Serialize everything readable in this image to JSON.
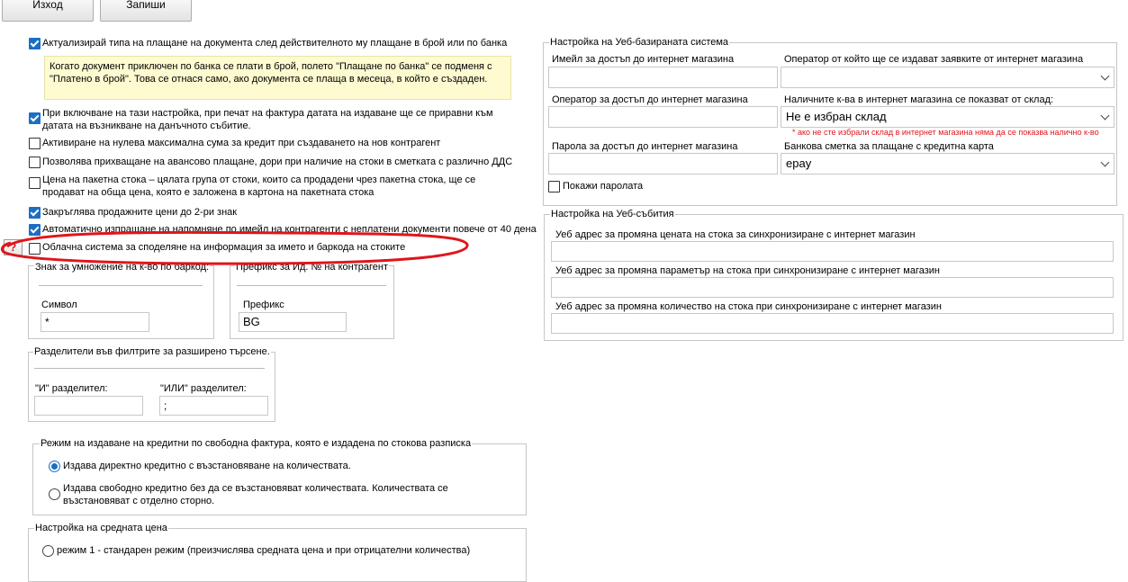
{
  "toolbar": {
    "exit_label": "Изход",
    "save_label": "Запиши"
  },
  "options": [
    {
      "label": "Актуализирай типа на плащане на документа след действителното му плащане в брой или по банка",
      "checked": true
    },
    {
      "label": "При включване на тази настройка, при печат на фактура датата на издаване ще се приравни към датата на възникване на данъчното събитие.",
      "checked": true
    },
    {
      "label": "Активиране на нулева максимална сума за кредит при създаването на нов контрагент",
      "checked": false
    },
    {
      "label": "Позволява прихващане на авансово плащане, дори при наличие на стоки в сметката с различно ДДС",
      "checked": false
    },
    {
      "label": "Цена на пакетна стока – цялата група от стоки, които са продадени чрез пакетна стока, ще се продават на обща цена, която е заложена в картона на пакетната стока",
      "checked": false
    },
    {
      "label": "Закръглява продажните цени до 2-ри знак",
      "checked": true
    },
    {
      "label": "Автоматично изпращане на напомняне по имейл на контрагенти с неплатени документи повече от 40 дена",
      "checked": true
    },
    {
      "label": "Облачна система за споделяне на информация за името и баркода на стоките",
      "checked": false
    }
  ],
  "note": "Когато документ приключен по банка се плати в брой, полето \"Плащане по банка\" се подменя с \"Платено в брой\". Това се отнася само, ако документа се плаща в месеца, в който е създаден.",
  "help_glyph": "?",
  "sign_group": {
    "legend": "Знак за умножение на к-во по баркод:",
    "label": "Символ",
    "value": "*"
  },
  "prefix_group": {
    "legend": "Префикс за Ид. № на контрагент",
    "label": "Префикс",
    "value": "BG"
  },
  "separators": {
    "legend": "Разделители във филтрите за разширено търсене.",
    "and_label": "\"И\" разделител:",
    "and_value": "",
    "or_label": "\"ИЛИ\" разделител:",
    "or_value": ";"
  },
  "credit_mode": {
    "legend": "Режим на издаване на кредитни по свободна фактура, която е издадена по стокова разписка",
    "options": [
      {
        "label": "Издава директно кредитно с възстановяване на количествата.",
        "selected": true
      },
      {
        "label": "Издава свободно кредитно без да се възстановяват количествата. Количествата се възстановяват с отделно сторно.",
        "selected": false
      }
    ]
  },
  "avg_price": {
    "legend": "Настройка на средната цена",
    "options": [
      {
        "label": "режим 1 - стандарен режим (преизчислява средната цена и при отрицателни количества)",
        "selected": false
      }
    ]
  },
  "web_system": {
    "legend": "Настройка на Уеб-базираната система",
    "email_label": "Имейл за достъп до интернет магазина",
    "email_value": "",
    "operator_issue_label": "Оператор от който ще се издават заявките от интернет магазина",
    "operator_issue_value": "",
    "operator_access_label": "Оператор за достъп до интернет магазина",
    "operator_access_value": "",
    "qty_label": "Наличните к-ва в интернет магазина се показват от склад:",
    "qty_value": "Не е избран склад",
    "qty_warning": "* ако не сте избрали склад в интернет магазина няма да се показва налично к-во",
    "password_label": "Парола за достъп до интернет магазина",
    "password_value": "",
    "bank_label": "Банкова сметка за плащане с кредитна карта",
    "bank_value": "epay",
    "show_password_label": "Покажи паролата",
    "show_password_checked": false
  },
  "web_events": {
    "legend": "Настройка на Уеб-събития",
    "price_label": "Уеб адрес за промяна цената на стока за синхронизиране с интернет магазин",
    "price_value": "",
    "param_label": "Уеб адрес за промяна параметър на стока  при синхронизиране с интернет магазин",
    "param_value": "",
    "qty_label": "Уеб адрес за промяна количество на стока  при синхронизиране с интернет магазин",
    "qty_value": ""
  },
  "colors": {
    "accent": "#1a6fc4",
    "highlight_circle": "#e0151b",
    "note_bg": "#fffbd1",
    "warning_text": "#e0151b"
  }
}
